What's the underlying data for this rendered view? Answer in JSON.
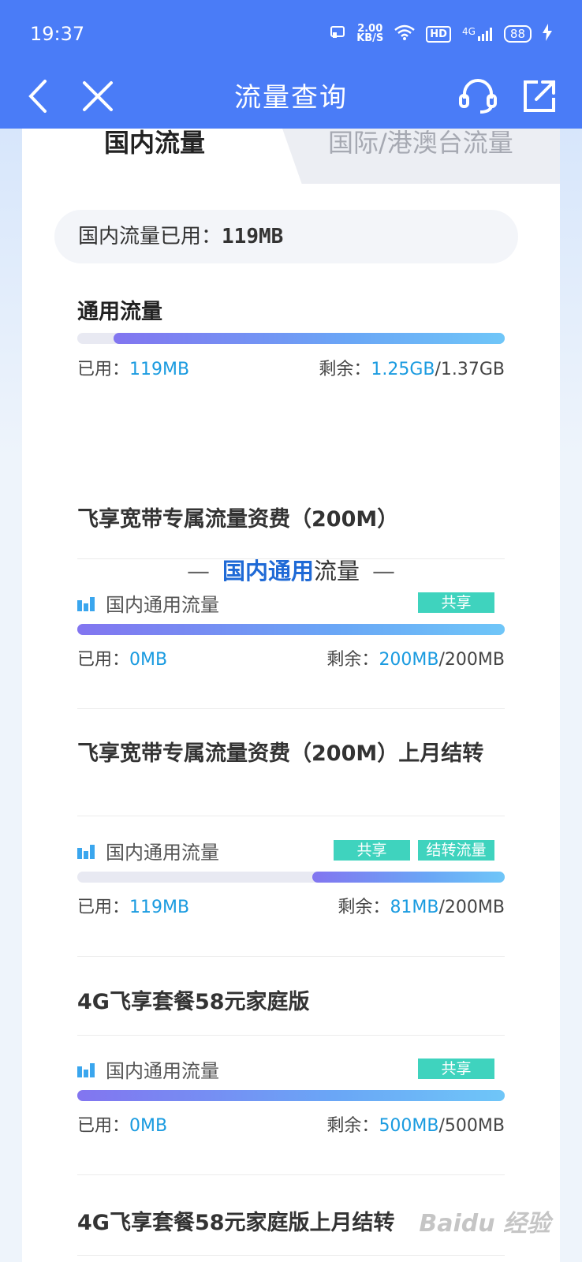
{
  "status": {
    "time": "19:37",
    "net_speed_value": "2.00",
    "net_speed_unit": "KB/S",
    "hd": "HD",
    "network": "4G",
    "battery": "88"
  },
  "nav": {
    "title": "流量查询",
    "icons": [
      "back-icon",
      "close-icon",
      "customer-service-icon",
      "share-icon"
    ]
  },
  "tabs": {
    "domestic": "国内流量",
    "international": "国际/港澳台流量"
  },
  "summary": {
    "label": "国内流量已用：",
    "value": "119MB"
  },
  "general": {
    "title": "通用流量",
    "used_label": "已用：",
    "used_value": "119MB",
    "remain_label": "剩余：",
    "remain_value": "1.25GB",
    "total": "/1.37GB",
    "used_fraction": 0.085
  },
  "divider": {
    "highlight": "国内通用",
    "rest": "流量",
    "dash": "—"
  },
  "packages": [
    {
      "title": "飞享宽带专属流量资费（200M）",
      "item_label": "国内通用流量",
      "tags": [
        "共享"
      ],
      "used_label": "已用：",
      "used_value": "0MB",
      "remain_label": "剩余：",
      "remain_value": "200MB",
      "total": "/200MB",
      "used_fraction": 0
    },
    {
      "title": "飞享宽带专属流量资费（200M）上月结转",
      "item_label": "国内通用流量",
      "tags": [
        "共享",
        "结转流量"
      ],
      "used_label": "已用：",
      "used_value": "119MB",
      "remain_label": "剩余：",
      "remain_value": "81MB",
      "total": "/200MB",
      "used_fraction": 0.55
    },
    {
      "title": "4G飞享套餐58元家庭版",
      "item_label": "国内通用流量",
      "tags": [
        "共享"
      ],
      "used_label": "已用：",
      "used_value": "0MB",
      "remain_label": "剩余：",
      "remain_value": "500MB",
      "total": "/500MB",
      "used_fraction": 0
    },
    {
      "title": "4G飞享套餐58元家庭版上月结转"
    }
  ],
  "watermark": "Baidu 经验",
  "colors": {
    "header": "#4a7cf7",
    "accent": "#1a9be0",
    "tag": "#3fd3be",
    "highlight": "#1f6ad6"
  }
}
